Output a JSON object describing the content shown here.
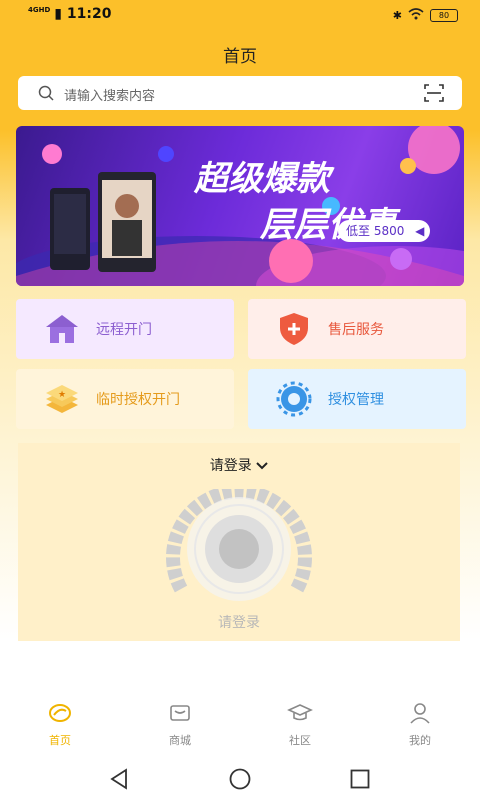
{
  "status_bar": {
    "time": "11:20",
    "network": "4GHD",
    "battery": "80"
  },
  "header": {
    "title": "首页"
  },
  "search": {
    "placeholder": "请输入搜索内容"
  },
  "banner": {
    "line1": "超级爆款",
    "line2": "层层优惠",
    "price": "低至 5800"
  },
  "actions": [
    {
      "label": "远程开门",
      "bg": "#f5e9ff",
      "color": "#8c5fd0"
    },
    {
      "label": "售后服务",
      "bg": "#ffeeea",
      "color": "#e8583d"
    },
    {
      "label": "临时授权开门",
      "bg": "#fff4da",
      "color": "#e59b1c"
    },
    {
      "label": "授权管理",
      "bg": "#e5f3ff",
      "color": "#2f8fe0"
    }
  ],
  "door_panel": {
    "account_label": "请登录",
    "hint": "请登录"
  },
  "tabs": [
    {
      "label": "首页",
      "icon": "home-icon",
      "active": true
    },
    {
      "label": "商城",
      "icon": "mall-icon",
      "active": false
    },
    {
      "label": "社区",
      "icon": "community-icon",
      "active": false
    },
    {
      "label": "我的",
      "icon": "profile-icon",
      "active": false
    }
  ],
  "colors": {
    "accent": "#fcc02a",
    "tab_active": "#f0b400",
    "tab_inactive": "#888888"
  }
}
